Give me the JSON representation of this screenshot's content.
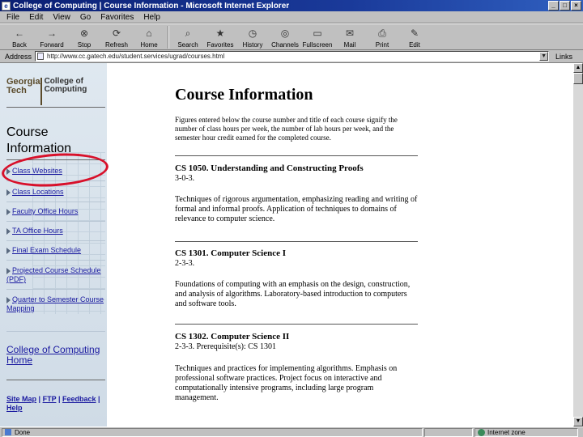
{
  "window": {
    "title": "College of Computing | Course Information - Microsoft Internet Explorer",
    "min_glyph": "_",
    "max_glyph": "□",
    "close_glyph": "×"
  },
  "menu": [
    "File",
    "Edit",
    "View",
    "Go",
    "Favorites",
    "Help"
  ],
  "toolbar": [
    {
      "label": "Back",
      "icon": "back-arrow-icon",
      "glyph": "←"
    },
    {
      "label": "Forward",
      "icon": "forward-arrow-icon",
      "glyph": "→"
    },
    {
      "label": "Stop",
      "icon": "stop-icon",
      "glyph": "⊗"
    },
    {
      "label": "Refresh",
      "icon": "refresh-icon",
      "glyph": "⟳"
    },
    {
      "label": "Home",
      "icon": "home-icon",
      "glyph": "⌂"
    },
    {
      "label": "Search",
      "icon": "search-icon",
      "glyph": "⌕"
    },
    {
      "label": "Favorites",
      "icon": "favorites-icon",
      "glyph": "★"
    },
    {
      "label": "History",
      "icon": "history-icon",
      "glyph": "◷"
    },
    {
      "label": "Channels",
      "icon": "channels-icon",
      "glyph": "◎"
    },
    {
      "label": "Fullscreen",
      "icon": "fullscreen-icon",
      "glyph": "▭"
    },
    {
      "label": "Mail",
      "icon": "mail-icon",
      "glyph": "✉"
    },
    {
      "label": "Print",
      "icon": "print-icon",
      "glyph": "⎙"
    },
    {
      "label": "Edit",
      "icon": "edit-icon",
      "glyph": "✎"
    }
  ],
  "address": {
    "label": "Address",
    "url": "http://www.cc.gatech.edu/student.services/ugrad/courses.html",
    "links_label": "Links"
  },
  "sidebar": {
    "logo_gt": "Georgia Tech",
    "logo_coc": "College of Computing",
    "heading_line1": "Course",
    "heading_line2": "Information",
    "links": [
      "Class Websites",
      "Class Locations",
      "Faculty Office Hours",
      "TA Office Hours",
      "Final Exam Schedule",
      "Projected Course Schedule (PDF)",
      "Quarter to Semester Course Mapping"
    ],
    "home_link": "College of Computing Home",
    "footer": {
      "site_map": "Site Map",
      "ftp": "FTP",
      "feedback": "Feedback",
      "help": "Help",
      "separator": "|"
    }
  },
  "main": {
    "title": "Course Information",
    "intro": "Figures entered below the course number and title of each course signify the number of class hours per week, the number of lab hours per week, and the semester hour credit earned for the completed course.",
    "courses": [
      {
        "title": "CS 1050. Understanding and Constructing Proofs",
        "hours": "3-0-3.",
        "desc": "Techniques of rigorous argumentation, emphasizing reading and writing of formal and informal proofs. Application of techniques to domains of relevance to computer science."
      },
      {
        "title": "CS 1301. Computer Science I",
        "hours": "2-3-3.",
        "desc": "Foundations of computing with an emphasis on the design, construction, and analysis of algorithms. Laboratory-based introduction to computers and software tools."
      },
      {
        "title": "CS 1302. Computer Science II",
        "hours": "2-3-3. Prerequisite(s): CS 1301",
        "desc": "Techniques and practices for implementing algorithms. Emphasis on professional software practices. Project focus on interactive and computationally intensive programs, including large program management."
      }
    ]
  },
  "status": {
    "left": "Done",
    "zone": "Internet zone"
  },
  "colors": {
    "title_bar": "#0a1f73",
    "link": "#1a1aa0",
    "highlight_ring": "#d8102a"
  }
}
